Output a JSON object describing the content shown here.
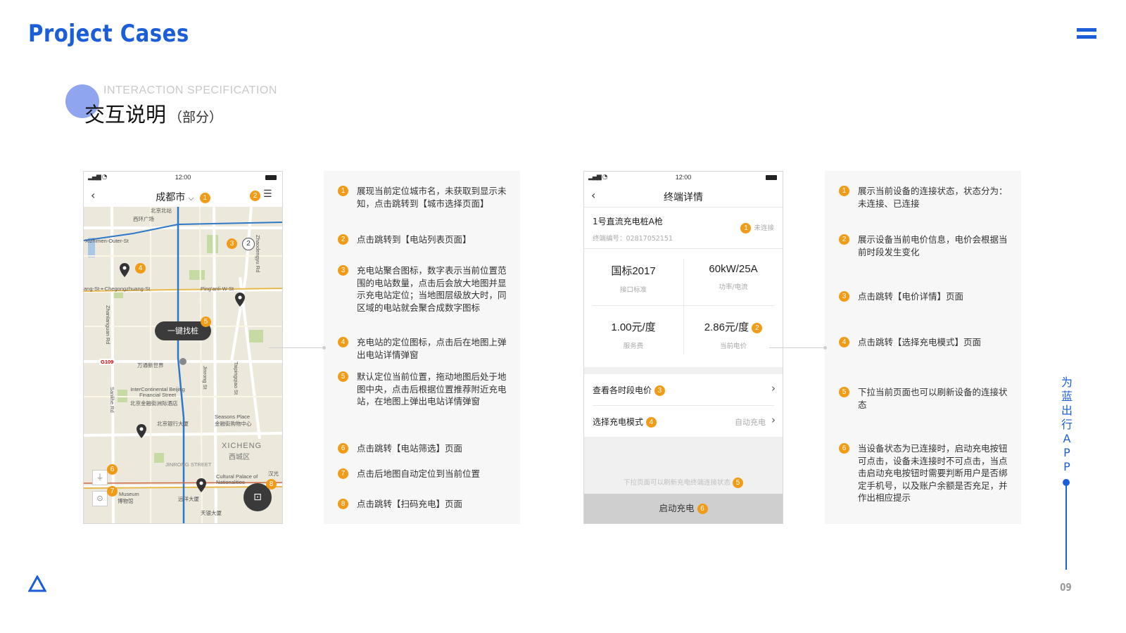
{
  "header": {
    "brand_title": "Project Cases",
    "section_en": "INTERACTION SPECIFICATION",
    "section_cn": "交互说明",
    "section_cn_note": "（部分）"
  },
  "phone_map": {
    "status_time": "12:00",
    "nav_title": "成都市",
    "find_button": "一键找桩",
    "cluster_count": "2",
    "map_labels": {
      "xizhimen": "Xizhimen-Outer-St",
      "xihuan": "西环广场",
      "beizhan": "北京北站",
      "chegongzhuang": "ang-St-▪-Chegongzhuang-St",
      "pinganli": "Ping'anli-W-St",
      "zhaodengyu": "Zhaodengyu Rd",
      "zhanlanguan": "Zhanlanguan Rd",
      "wantong": "万通新世界",
      "g109": "G109",
      "intercontinental": "InterContinental Beijing Financial Street",
      "intercontinental_cn": "北京金融街洲际酒店",
      "seasons": "Seasons Place",
      "seasons_cn": "金融街购物中心",
      "bocbank": "北京银行大厦",
      "xicheng": "XICHENG",
      "xicheng_cn": "西城区",
      "jinrong": "JINRONG STREET",
      "cultural": "Cultural Palace of Nationalities",
      "museum": "Museum",
      "museum_cn": "博物馆",
      "yuanyang": "远洋大厦",
      "tianyin": "天银大厦",
      "hanguang": "汉光",
      "sanlihe": "Sanlihe Rd",
      "jinrong_st": "Jinrong St",
      "taipingqiao": "Taipingqiao St"
    }
  },
  "desc_left": {
    "items": [
      {
        "num": "1",
        "text": "展现当前定位城市名，未获取到显示未知，点击跳转到【城市选择页面】"
      },
      {
        "num": "2",
        "text": "点击跳转到【电站列表页面】"
      },
      {
        "num": "3",
        "text": "充电站聚合图标，数字表示当前位置范围的电站数量，点击后会放大地图并显示充电站定位；当地图层级放大时，同区域的电站就会聚合成数字图标"
      },
      {
        "num": "4",
        "text": "充电站的定位图标，点击后在地图上弹出电站详情弹窗"
      },
      {
        "num": "5",
        "text": "默认定位当前位置，拖动地图后处于地图中央，点击后根据位置推荐附近充电站，在地图上弹出电站详情弹窗"
      },
      {
        "num": "6",
        "text": "点击跳转【电站筛选】页面"
      },
      {
        "num": "7",
        "text": "点击后地图自动定位到当前位置"
      },
      {
        "num": "8",
        "text": "点击跳转【扫码充电】页面"
      }
    ]
  },
  "phone_detail": {
    "status_time": "12:00",
    "nav_title": "终端详情",
    "terminal_name": "1号直流充电桩A枪",
    "terminal_code": "终端编号：02817052151",
    "connection_status": "未连接",
    "specs": [
      {
        "value": "国标2017",
        "label": "接口标准"
      },
      {
        "value": "60kW/25A",
        "label": "功率/电流"
      },
      {
        "value": "1.00元/度",
        "label": "服务费"
      },
      {
        "value": "2.86元/度",
        "label": "当前电价"
      }
    ],
    "row_price": "查看各时段电价",
    "row_mode": "选择充电模式",
    "row_mode_value": "自动充电",
    "pull_hint": "下拉页面可以刷新充电终端连接状态",
    "start_button": "启动充电"
  },
  "desc_right": {
    "items": [
      {
        "num": "1",
        "text": "展示当前设备的连接状态，状态分为：未连接、已连接"
      },
      {
        "num": "2",
        "text": "展示设备当前电价信息，电价会根据当前时段发生变化"
      },
      {
        "num": "3",
        "text": "点击跳转【电价详情】页面"
      },
      {
        "num": "4",
        "text": "点击跳转【选择充电模式】页面"
      },
      {
        "num": "5",
        "text": "下拉当前页面也可以刷新设备的连接状态"
      },
      {
        "num": "6",
        "text": "当设备状态为已连接时，启动充电按钮可点击，设备未连接时不可点击，当点击启动充电按钮时需要判断用户是否绑定手机号，以及账户余额是否充足，并作出相应提示"
      }
    ]
  },
  "side": {
    "vertical_title": "为蓝出行APP",
    "page_number": "09"
  },
  "colors": {
    "brand_blue": "#1b5ed8",
    "badge_orange": "#f29b16",
    "panel_bg": "#f7f7f7"
  },
  "icons": {
    "menu": "hamburger-icon",
    "back": "chevron-left-icon",
    "list": "list-icon",
    "pin": "map-pin-icon",
    "scan": "scan-icon",
    "filter": "filter-icon",
    "locate": "locate-icon",
    "triangle": "triangle-logo-icon"
  }
}
